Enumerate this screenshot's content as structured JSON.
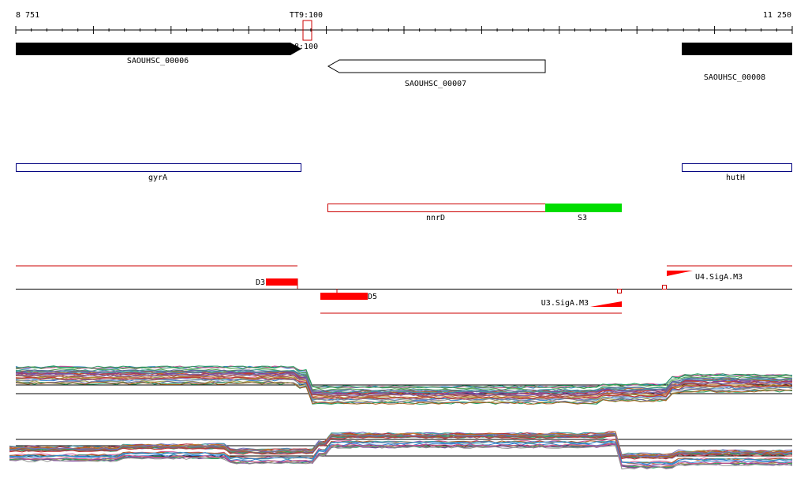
{
  "ruler": {
    "start_label": "8 751",
    "end_label": "11 250",
    "marker_label": "TT9:100",
    "marker_sub_label": "8:100"
  },
  "genes": [
    {
      "id": "SAOUHSC_00006",
      "label": "SAOUHSC_00006",
      "strand": "+",
      "filled": true
    },
    {
      "id": "SAOUHSC_00007",
      "label": "SAOUHSC_00007",
      "strand": "-",
      "filled": false
    },
    {
      "id": "SAOUHSC_00008",
      "label": "SAOUHSC_00008",
      "strand": "+",
      "filled": true
    }
  ],
  "regions": [
    {
      "id": "gyrA",
      "label": "gyrA",
      "color": "#00007f"
    },
    {
      "id": "hutH",
      "label": "hutH",
      "color": "#00007f"
    },
    {
      "id": "nnrD",
      "label": "nnrD",
      "color": "#cc0000"
    },
    {
      "id": "S3",
      "label": "S3",
      "color": "#00dd00"
    }
  ],
  "features": {
    "d3": "D3",
    "d5": "D5",
    "u3": "U3.SigA.M3",
    "u4": "U4.SigA.M3"
  },
  "colors": {
    "feature_red": "#ff0000",
    "line_red": "#cc0000",
    "gene_black": "#000000",
    "region_blue": "#00007f",
    "region_green": "#00dd00"
  },
  "profile_colors": [
    "#a05050",
    "#7070c0",
    "#50a050",
    "#c08030",
    "#8040a0",
    "#40a0a0",
    "#a0a040",
    "#d05090",
    "#6060a0",
    "#3080d0",
    "#909090",
    "#b06020",
    "#20a060",
    "#c03030"
  ]
}
